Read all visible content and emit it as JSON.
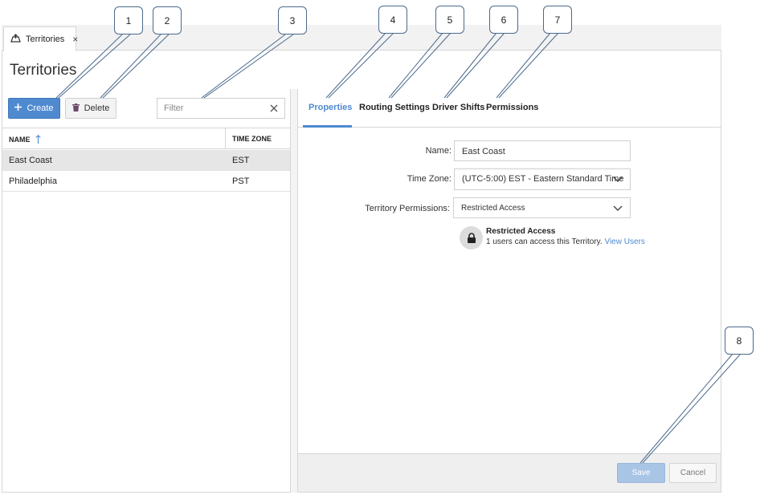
{
  "tab": {
    "label": "Territories",
    "icon": "territory-icon",
    "close_glyph": "×"
  },
  "page_title": "Territories",
  "toolbar": {
    "create_label": "Create",
    "delete_label": "Delete",
    "filter_placeholder": "Filter",
    "filter_value": ""
  },
  "table": {
    "headers": {
      "name": "NAME",
      "timezone": "TIME ZONE"
    },
    "sort": {
      "column": "name",
      "direction": "ascending"
    },
    "rows": [
      {
        "name": "East Coast",
        "timezone": "EST",
        "selected": true
      },
      {
        "name": "Philadelphia",
        "timezone": "PST",
        "selected": false
      }
    ]
  },
  "detail": {
    "tabs": [
      {
        "label": "Properties",
        "active": true
      },
      {
        "label": "Routing Settings",
        "active": false
      },
      {
        "label": "Driver Shifts",
        "active": false
      },
      {
        "label": "Permissions",
        "active": false
      }
    ],
    "form": {
      "name_label": "Name:",
      "name_value": "East Coast",
      "timezone_label": "Time Zone:",
      "timezone_value": "(UTC-5:00) EST - Eastern Standard Time",
      "permissions_label": "Territory Permissions:",
      "permissions_value": "Restricted Access"
    },
    "access_info": {
      "title": "Restricted Access",
      "description": "1 users can access this Territory.",
      "link": "View Users"
    }
  },
  "footer": {
    "save_label": "Save",
    "cancel_label": "Cancel"
  },
  "callouts": [
    "1",
    "2",
    "3",
    "4",
    "5",
    "6",
    "7",
    "8"
  ],
  "colors": {
    "accent": "#4f8ad0",
    "selected_row": "#e6e6e6",
    "save_disabled": "#a9c5e6"
  }
}
